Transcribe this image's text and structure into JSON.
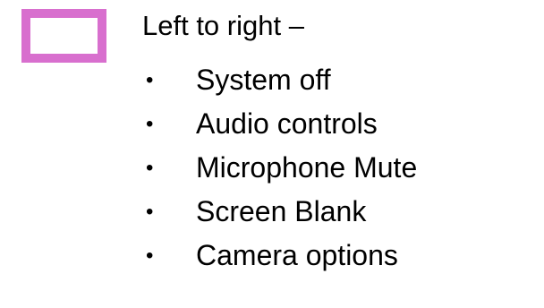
{
  "legend": {
    "swatch_color": "#d86fce"
  },
  "heading": "Left to right –",
  "items": [
    "System off",
    "Audio controls",
    "Microphone Mute",
    "Screen Blank",
    "Camera options"
  ]
}
